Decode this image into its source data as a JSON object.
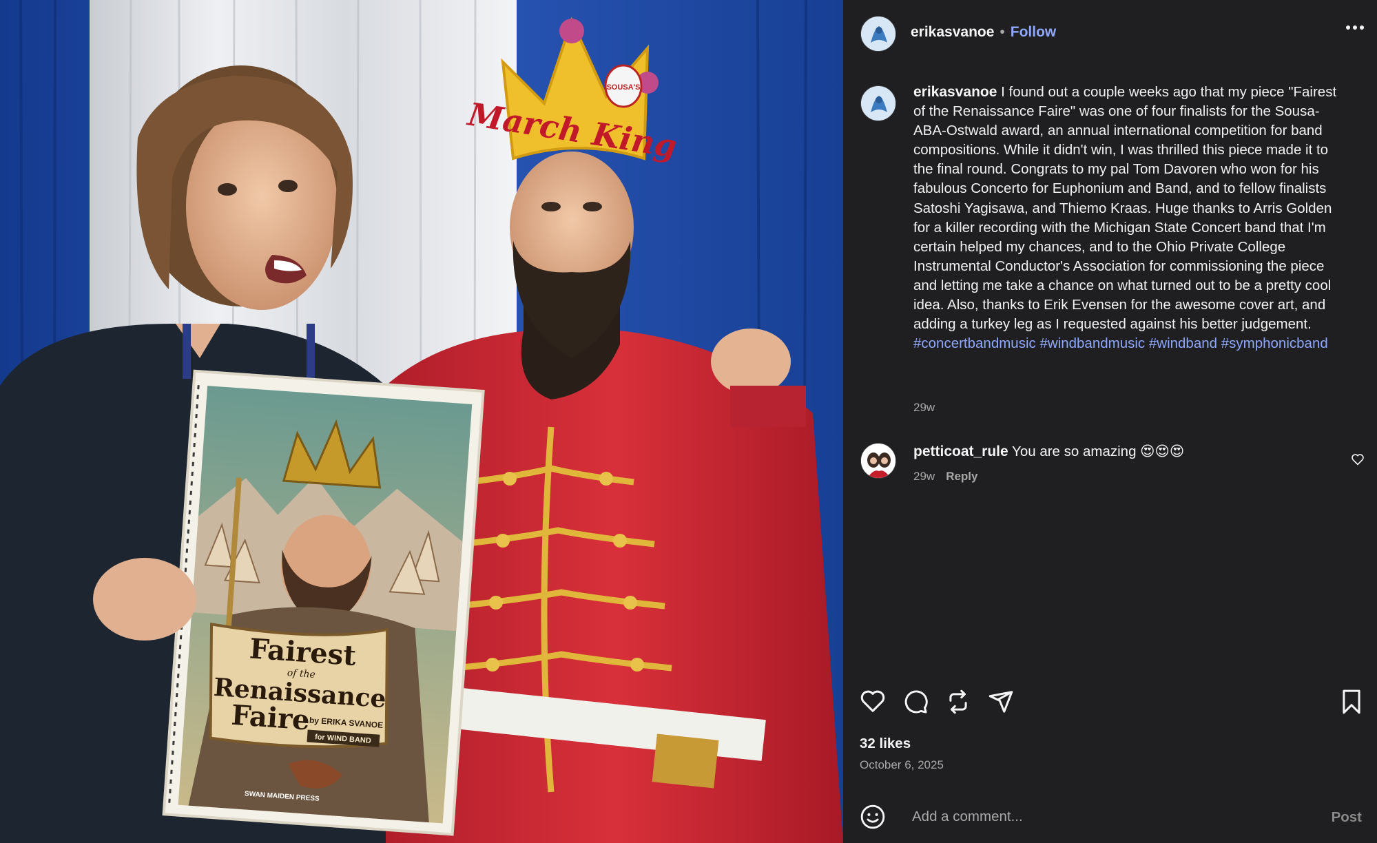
{
  "post": {
    "username": "erikasvanoe",
    "follow_label": "Follow",
    "caption_username": "erikasvanoe",
    "caption_text": "I found out a couple weeks ago that my piece \"Fairest of the Renaissance Faire\" was one of four finalists for the Sousa-ABA-Ostwald award, an annual international competition for band compositions. While it didn't win, I was thrilled this piece made it to the final round. Congrats to my pal Tom Davoren who won for his fabulous Concerto for Euphonium and Band, and to fellow finalists Satoshi Yagisawa, and Thiemo Kraas. Huge thanks to Arris Golden for a killer recording with the Michigan State Concert band that I'm certain helped my chances, and to the Ohio Private College Instrumental Conductor's Association for commissioning the piece and letting me take a chance on what turned out to be a pretty cool idea. Also, thanks to Erik Evensen for the awesome cover art, and adding a turkey leg as I requested against his better judgement.",
    "hashtags": [
      "#concertbandmusic",
      "#windbandmusic",
      "#windband",
      "#symphonicband"
    ],
    "caption_time": "29w",
    "likes": "32 likes",
    "date": "October 6, 2025"
  },
  "comments": [
    {
      "username": "petticoat_rule",
      "text": "You are so amazing 😍😍😍",
      "time": "29w",
      "reply_label": "Reply"
    }
  ],
  "add_comment": {
    "placeholder": "Add a comment...",
    "post_label": "Post"
  },
  "photo": {
    "crown_text": "March King",
    "crown_badge": "SOUSA'S",
    "score_title_1": "Fairest",
    "score_title_2": "of the",
    "score_title_3": "Renaissance",
    "score_title_4": "Faire",
    "score_byline": "by ERIKA SVANOE",
    "score_for": "for WIND BAND",
    "publisher": "SWAN MAIDEN PRESS"
  },
  "icons": {
    "more": "more-options-icon",
    "like": "heart-icon",
    "comment": "comment-icon",
    "repost": "repost-icon",
    "share": "share-icon",
    "save": "bookmark-icon",
    "emoji": "emoji-icon"
  },
  "colors": {
    "link": "#8ea8ff",
    "panel_bg": "#1f1f21",
    "text": "#f5f5f5",
    "muted": "#a8a8a8"
  }
}
